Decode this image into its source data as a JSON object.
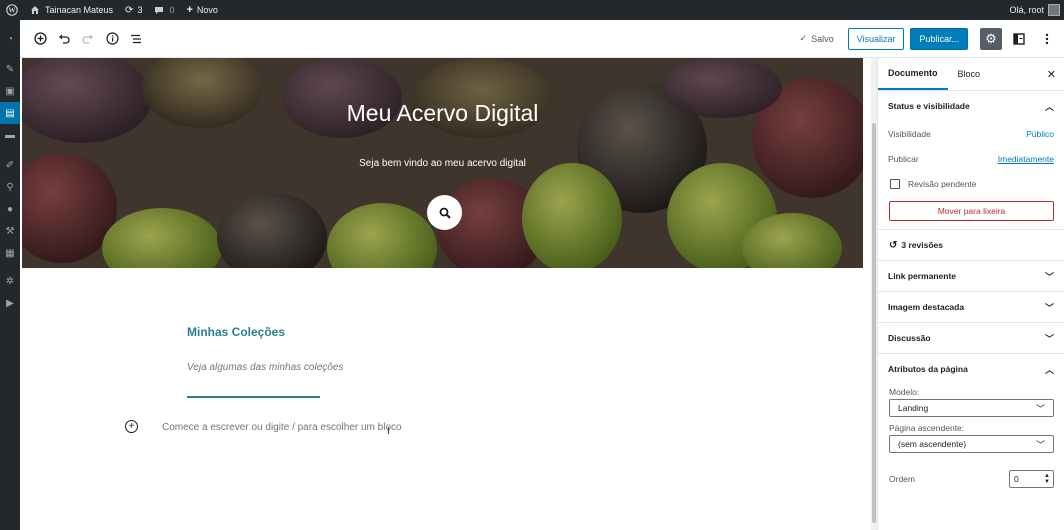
{
  "adminbar": {
    "site_name": "Tainacan Mateus",
    "updates_count": "3",
    "comments_count": "0",
    "new_label": "Novo",
    "greeting": "Olá, root"
  },
  "toolbar": {
    "saved_label": "Salvo",
    "preview_label": "Visualizar",
    "publish_label": "Publicar..."
  },
  "hero": {
    "title": "Meu Acervo Digital",
    "subtitle": "Seja bem vindo ao meu acervo digital"
  },
  "content": {
    "collections_title": "Minhas Coleções",
    "collections_subtitle": "Veja algumas das minhas coleções",
    "block_placeholder": "Comece a escrever ou digite / para escolher um bloco"
  },
  "sidebar": {
    "tab_document": "Documento",
    "tab_block": "Bloco",
    "status": {
      "title": "Status e visibilidade",
      "visibility_label": "Visibilidade",
      "visibility_value": "Público",
      "publish_label": "Publicar",
      "publish_value": "Imediatamente",
      "pending_label": "Revisão pendente",
      "trash_label": "Mover para lixeira"
    },
    "revisions": "3 revisões",
    "permalink": "Link permanente",
    "featured_image": "Imagem destacada",
    "discussion": "Discussão",
    "page_attributes": {
      "title": "Atributos da página",
      "template_label": "Modelo:",
      "template_value": "Landing",
      "parent_label": "Página ascendente:",
      "parent_value": "(sem ascendente)",
      "order_label": "Ordem",
      "order_value": "0"
    }
  }
}
